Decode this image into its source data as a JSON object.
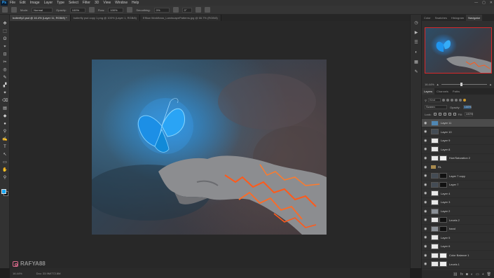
{
  "menubar": {
    "logo": "Ps",
    "items": [
      "File",
      "Edit",
      "Image",
      "Layer",
      "Type",
      "Select",
      "Filter",
      "3D",
      "View",
      "Window",
      "Help"
    ]
  },
  "options": {
    "mode_label": "Mode:",
    "mode_value": "Normal",
    "opacity_label": "Opacity:",
    "opacity_value": "100%",
    "flow_label": "Flow:",
    "flow_value": "100%",
    "smoothing_label": "Smoothing:",
    "smoothing_value": "0%",
    "angle_value": "0°"
  },
  "tabs": [
    {
      "label": "butterfly2.psd @ 16.4% (Layer 11, RGB/8) *",
      "active": true
    },
    {
      "label": "butterfly psd copy 1.png @ 100% (Layer 1, RGB/8)",
      "active": false
    },
    {
      "label": "Efflow Workflows_LandscapePatterns.jpg @ 66.7% (RGB/8)",
      "active": false
    }
  ],
  "tools": [
    "✥",
    "⬚",
    "ʘ",
    "⌖",
    "⊡",
    "✂",
    "◎",
    "✎",
    "▞",
    "✦",
    "⌫",
    "▤",
    "◆",
    "●",
    "⚲",
    "✍",
    "T",
    "↖",
    "▭",
    "✋",
    "⚲"
  ],
  "status": {
    "zoom": "16.44%",
    "doc": "Doc: 33.9M/772.8M"
  },
  "watermark": "RAFYA88",
  "panel_tabs_top": [
    "Color",
    "Swatches",
    "Histogram",
    "Navigator"
  ],
  "navigator": {
    "zoom": "16.44%"
  },
  "panel_tabs_layers": [
    "Layers",
    "Channels",
    "Paths"
  ],
  "layers_panel": {
    "filter_kind": "Kind",
    "blend_mode": "Screen",
    "opacity_label": "Opacity:",
    "opacity_value": "100%",
    "lock_label": "Lock:",
    "fill_label": "Fill:",
    "fill_value": "100%"
  },
  "layers": [
    {
      "name": "Layer 11",
      "selected": true,
      "thumb": "blue",
      "mask": null
    },
    {
      "name": "Layer 10",
      "selected": false,
      "thumb": "dark",
      "mask": null
    },
    {
      "name": "Layer 9",
      "selected": false,
      "thumb": "white",
      "mask": null
    },
    {
      "name": "Layer 8",
      "selected": false,
      "thumb": "white",
      "mask": null
    },
    {
      "name": "Hue/Saturation 2",
      "selected": false,
      "thumb": "white",
      "mask": "white"
    },
    {
      "name": "RL",
      "selected": false,
      "thumb": "group",
      "mask": null
    },
    {
      "name": "Layer 7 copy",
      "selected": false,
      "thumb": "dark",
      "mask": "black"
    },
    {
      "name": "Layer 7",
      "selected": false,
      "thumb": "dark",
      "mask": "black"
    },
    {
      "name": "Layer 4",
      "selected": false,
      "thumb": "white",
      "mask": null
    },
    {
      "name": "Layer 3",
      "selected": false,
      "thumb": "white",
      "mask": null
    },
    {
      "name": "Layer 2",
      "selected": false,
      "thumb": "normal",
      "mask": null
    },
    {
      "name": "Levels 2",
      "selected": false,
      "thumb": "white",
      "mask": "black"
    },
    {
      "name": "hand",
      "selected": false,
      "thumb": "normal",
      "mask": "black"
    },
    {
      "name": "Layer 5",
      "selected": false,
      "thumb": "white",
      "mask": null
    },
    {
      "name": "Layer 6",
      "selected": false,
      "thumb": "white",
      "mask": null
    },
    {
      "name": "Color Balance 1",
      "selected": false,
      "thumb": "white",
      "mask": "white"
    },
    {
      "name": "Levels 1",
      "selected": false,
      "thumb": "white",
      "mask": "white"
    }
  ]
}
